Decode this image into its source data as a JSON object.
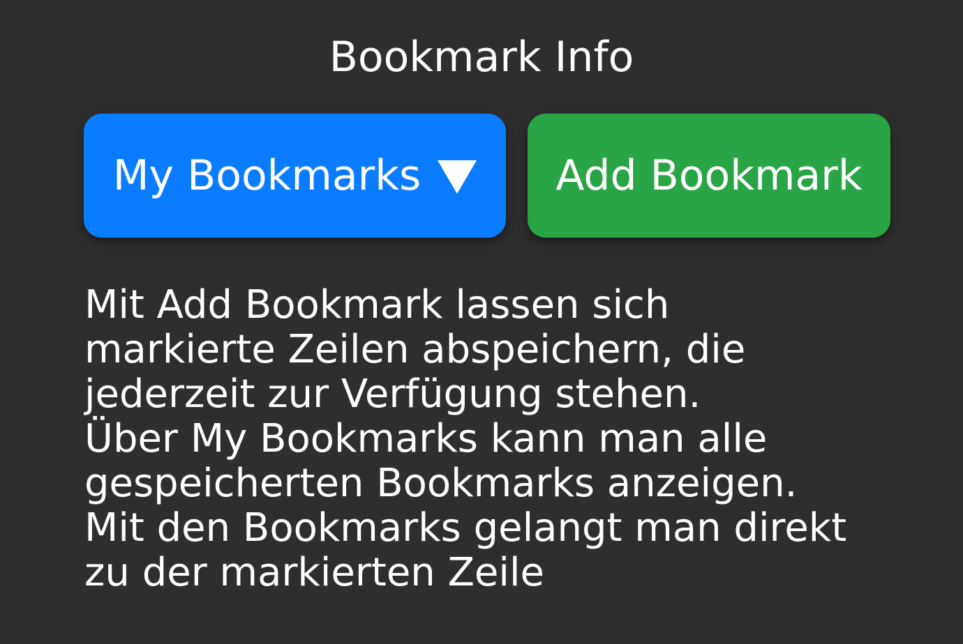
{
  "header": {
    "title": "Bookmark Info"
  },
  "buttons": {
    "my_bookmarks_label": "My Bookmarks",
    "add_bookmark_label": "Add Bookmark"
  },
  "description": {
    "lines": [
      "Mit Add Bookmark lassen sich",
      "markierte Zeilen abspeichern, die",
      "jederzeit zur Verfügung stehen.",
      "Über My Bookmarks kann man alle",
      "gespeicherten Bookmarks anzeigen.",
      "Mit den Bookmarks gelangt man direkt",
      "zu der markierten Zeile"
    ]
  },
  "icons": {
    "dropdown": "caret-down-icon"
  },
  "colors": {
    "background": "#2f2e2f",
    "my_bookmarks_button": "#0a7cff",
    "add_bookmark_button": "#29a545",
    "text": "#ffffff"
  }
}
